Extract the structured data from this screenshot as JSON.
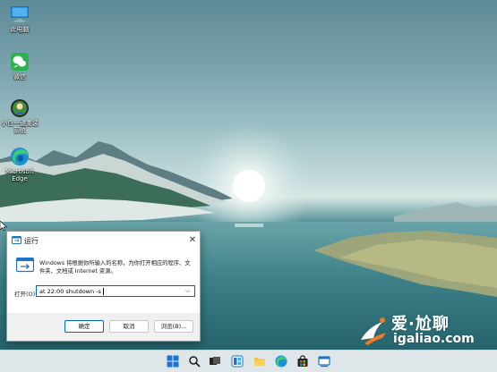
{
  "desktop": {
    "icons": [
      {
        "label": "此电脑",
        "icon": "computer-icon"
      },
      {
        "label": "微信",
        "icon": "wechat-icon"
      },
      {
        "label": "小白一键重装系统",
        "icon": "reinstall-tool-icon"
      },
      {
        "label": "Microsoft Edge",
        "icon": "edge-icon"
      }
    ]
  },
  "run_dialog": {
    "title": "运行",
    "description": "Windows 将根据你所输入的名称，为你打开相应的程序、文件夹、文档或 Internet 资源。",
    "open_label": "打开(O):",
    "command_value": "at 22:00 shutdown -s",
    "ok_label": "确定",
    "cancel_label": "取消",
    "browse_label": "浏览(B)..."
  },
  "taskbar": {
    "icons": [
      "windows-start-icon",
      "search-icon",
      "task-view-icon",
      "widgets-icon",
      "file-explorer-icon",
      "edge-icon",
      "store-icon",
      "app-icon"
    ]
  },
  "watermark": {
    "title": "爱·尬聊",
    "subtitle": "igaliao.com"
  },
  "colors": {
    "accent": "#0067c0",
    "taskbar": "#dfe6ea"
  }
}
